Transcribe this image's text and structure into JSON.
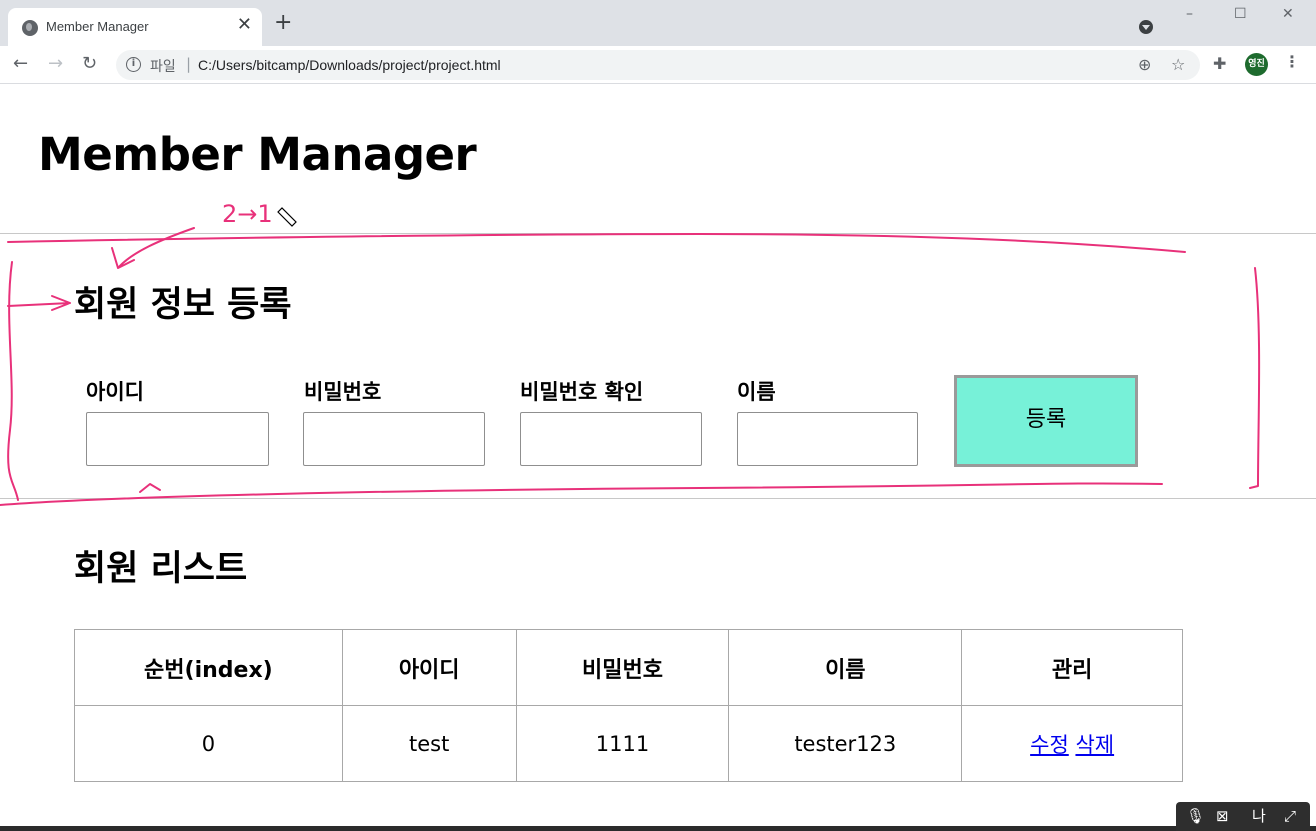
{
  "browser": {
    "tab_title": "Member Manager",
    "tab_close": "✕",
    "new_tab": "+",
    "url_scheme": "파일",
    "url_separator": "|",
    "url": "C:/Users/bitcamp/Downloads/project/project.html",
    "avatar_text": "영진",
    "window_controls": [
      "–",
      "☐",
      "✕"
    ],
    "nav": {
      "back": "←",
      "forward": "→",
      "reload": "↻"
    }
  },
  "page": {
    "title": "Member Manager",
    "register_section": {
      "title": "회원 정보 등록",
      "fields": [
        {
          "label": "아이디",
          "value": ""
        },
        {
          "label": "비밀번호",
          "value": ""
        },
        {
          "label": "비밀번호 확인",
          "value": ""
        },
        {
          "label": "이름",
          "value": ""
        }
      ],
      "submit_label": "등록",
      "submit_color": "#77f1d8"
    },
    "list_section": {
      "title": "회원 리스트",
      "columns": [
        "순번(index)",
        "아이디",
        "비밀번호",
        "이름",
        "관리"
      ],
      "rows": [
        {
          "index": "0",
          "id": "test",
          "password": "1111",
          "name": "tester123",
          "edit": "수정",
          "delete": "삭제"
        }
      ]
    }
  },
  "annotation": {
    "handwriting": "2→1",
    "color": "#e8317a"
  },
  "share_widget": {
    "label": "나",
    "icons": [
      "mic-muted-icon",
      "camera-off-icon",
      "expand-icon"
    ]
  }
}
